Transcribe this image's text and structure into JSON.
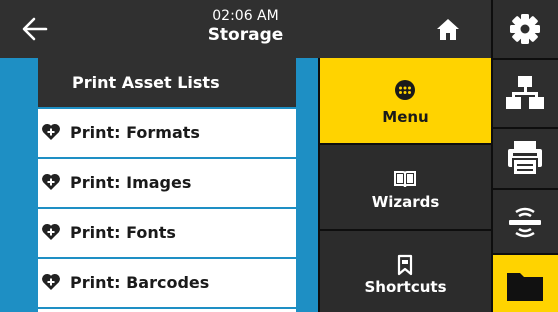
{
  "header": {
    "time": "02:06 AM",
    "title": "Storage"
  },
  "list": {
    "header": "Print Asset Lists",
    "items": [
      {
        "label": "Print: Formats"
      },
      {
        "label": "Print: Images"
      },
      {
        "label": "Print: Fonts"
      },
      {
        "label": "Print: Barcodes"
      }
    ]
  },
  "nav": {
    "menu": "Menu",
    "wizards": "Wizards",
    "shortcuts": "Shortcuts"
  },
  "sidebar": {
    "items": [
      {
        "icon": "gear-icon"
      },
      {
        "icon": "network-icon"
      },
      {
        "icon": "printer-icon"
      },
      {
        "icon": "rfid-icon"
      },
      {
        "icon": "folder-icon",
        "active": true
      }
    ]
  },
  "colors": {
    "accent": "#ffd300",
    "panel": "#1e8fc4",
    "dark": "#2c2c2c"
  }
}
